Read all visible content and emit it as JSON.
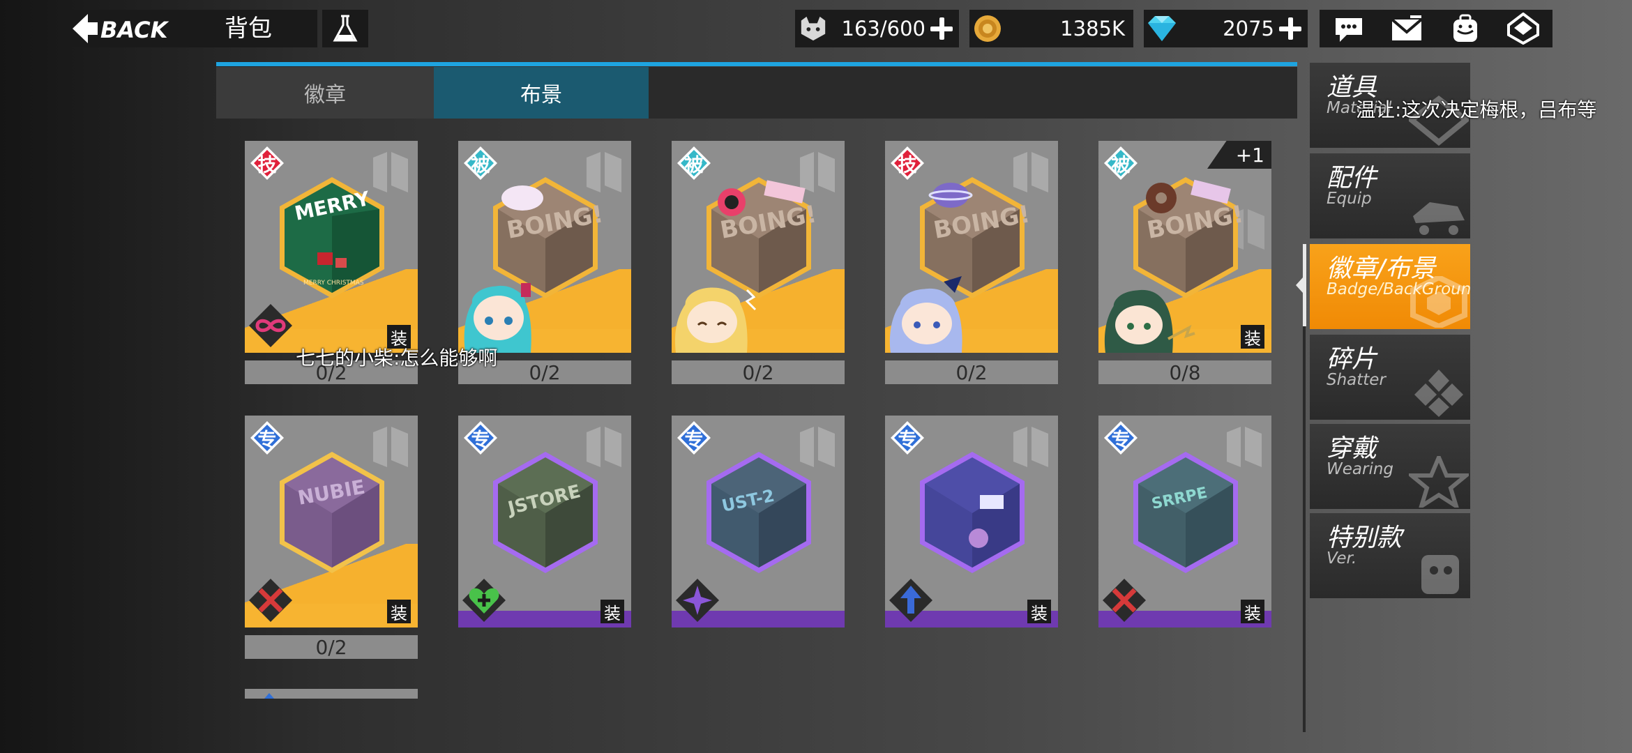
{
  "header": {
    "back_label": "BACK",
    "title": "背包"
  },
  "resources": [
    {
      "name": "stamina",
      "icon": "cat-head-icon",
      "value": "163/600",
      "has_plus": true
    },
    {
      "name": "coin",
      "icon": "coin-icon",
      "value": "1385K",
      "has_plus": false
    },
    {
      "name": "diamond",
      "icon": "diamond-icon",
      "value": "2075",
      "has_plus": true
    }
  ],
  "top_icons": [
    "chat-icon",
    "mail-icon",
    "backpack-icon",
    "rank-icon"
  ],
  "tabs": [
    {
      "label": "徽章",
      "active": false
    },
    {
      "label": "布景",
      "active": true
    }
  ],
  "cards_row1": [
    {
      "type_char": "技",
      "type_color": "#e0203a",
      "art": "merry-christmas-hex",
      "equip": "装",
      "count": "0/2",
      "category_icon": "infinity-icon",
      "chibi": null
    },
    {
      "type_char": "被",
      "type_color": "#35b8c8",
      "art": "boing-box-hex",
      "equip": null,
      "count": "0/2",
      "category_icon": null,
      "chibi": "miku-chibi"
    },
    {
      "type_char": "被",
      "type_color": "#35b8c8",
      "art": "boing-box-hex",
      "equip": null,
      "count": "0/2",
      "category_icon": null,
      "chibi": "blonde-chibi"
    },
    {
      "type_char": "技",
      "type_color": "#e0203a",
      "art": "boing-box-hex",
      "equip": null,
      "count": "0/2",
      "category_icon": null,
      "chibi": "blue-hair-chibi"
    },
    {
      "type_char": "被",
      "type_color": "#35b8c8",
      "art": "boing-box-hex",
      "equip": "装",
      "count": "0/8",
      "category_icon": null,
      "chibi": "green-hair-chibi",
      "extra": "+1"
    }
  ],
  "cards_row2": [
    {
      "type_char": "专",
      "type_color": "#2f6fd8",
      "art": "nubie-box-hex",
      "equip": "装",
      "count": "0/2",
      "category_icon": "crossed-swords-icon",
      "stripe": "gold"
    },
    {
      "type_char": "专",
      "type_color": "#2f6fd8",
      "art": "jstore-box-hex",
      "equip": "装",
      "count": null,
      "category_icon": "heart-plus-icon",
      "stripe": "purple"
    },
    {
      "type_char": "专",
      "type_color": "#2f6fd8",
      "art": "ust-box-hex",
      "equip": null,
      "count": null,
      "category_icon": "shuriken-icon",
      "stripe": "purple"
    },
    {
      "type_char": "专",
      "type_color": "#2f6fd8",
      "art": "arcade-box-hex",
      "equip": "装",
      "count": null,
      "category_icon": "up-arrow-diamond-icon",
      "stripe": "purple"
    },
    {
      "type_char": "专",
      "type_color": "#2f6fd8",
      "art": "teal-box-hex",
      "equip": "装",
      "count": null,
      "category_icon": "crossed-swords-icon",
      "stripe": "purple"
    }
  ],
  "side_menu": [
    {
      "cn": "道具",
      "en": "Material",
      "active": false,
      "icon": "material-icon"
    },
    {
      "cn": "配件",
      "en": "Equip",
      "active": false,
      "icon": "skate-icon"
    },
    {
      "cn": "徽章/布景",
      "en": "Badge/BackGround",
      "active": true,
      "icon": "hex-badge-icon"
    },
    {
      "cn": "碎片",
      "en": "Shatter",
      "active": false,
      "icon": "shatter-icon"
    },
    {
      "cn": "穿戴",
      "en": "Wearing",
      "active": false,
      "icon": "star-icon"
    },
    {
      "cn": "特别款",
      "en": "Ver.",
      "active": false,
      "icon": "special-icon"
    }
  ],
  "danmaku": [
    "七七的小柴:怎么能够啊",
    "温让:这次决定梅根，吕布等"
  ],
  "colors": {
    "accent_blue": "#1ea4e0",
    "active_orange": "#f39a10",
    "gold_stripe": "#f6b12e",
    "purple_stripe": "#6f3ab0"
  }
}
